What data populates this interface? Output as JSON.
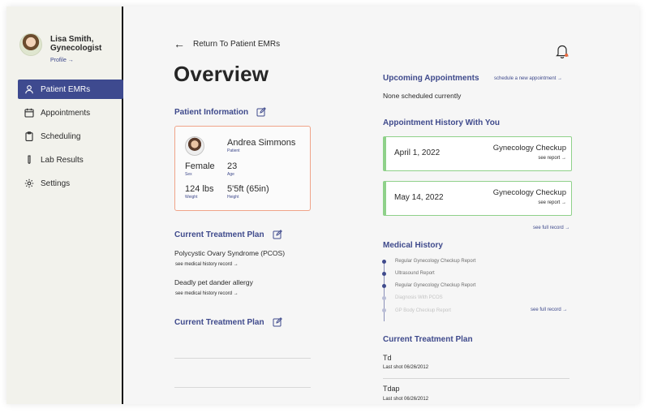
{
  "sidebar": {
    "profile_name": "Lisa Smith, Gynecologist",
    "profile_link": "Profile →",
    "items": [
      {
        "label": "Patient EMRs",
        "active": true
      },
      {
        "label": "Appointments"
      },
      {
        "label": "Scheduling"
      },
      {
        "label": "Lab Results"
      },
      {
        "label": "Settings"
      }
    ]
  },
  "header": {
    "back_label": "Return To Patient EMRs",
    "title": "Overview"
  },
  "patient_info": {
    "heading": "Patient Information",
    "name": "Andrea Simmons",
    "name_caption": "Patient",
    "sex": "Female",
    "sex_caption": "Sex",
    "age": "23",
    "age_caption": "Age",
    "weight": "124 lbs",
    "weight_caption": "Weight",
    "height": "5'5ft (65in)",
    "height_caption": "Height"
  },
  "treatment_plan_left": {
    "heading": "Current Treatment Plan",
    "items": [
      {
        "label": "Polycystic Ovary Syndrome (PCOS)",
        "link": "see medical history record →"
      },
      {
        "label": "Deadly pet dander allergy",
        "link": "see medical history record →"
      }
    ]
  },
  "treatment_plan_left_2": {
    "heading": "Current Treatment Plan"
  },
  "upcoming": {
    "heading": "Upcoming Appointments",
    "link": "schedule a new appointment →",
    "empty": "None scheduled currently"
  },
  "history": {
    "heading": "Appointment History With You",
    "cards": [
      {
        "date": "April 1, 2022",
        "type": "Gynecology Checkup",
        "link": "see report →"
      },
      {
        "date": "May 14, 2022",
        "type": "Gynecology Checkup",
        "link": "see report →"
      }
    ],
    "full_link": "see full record →"
  },
  "medical_history": {
    "heading": "Medical History",
    "items": [
      "Regular Gynecology Checkup Report",
      "Ultrasound Report",
      "Regular Gynecology Checkup Report",
      "Diagnosis With PCOS",
      "GP Body Checkup Report"
    ],
    "full_link": "see full record →"
  },
  "treatment_plan_right": {
    "heading": "Current Treatment Plan",
    "items": [
      {
        "name": "Td",
        "sub": "Last shot 06/26/2012"
      },
      {
        "name": "Tdap",
        "sub": "Last shot 06/26/2012"
      }
    ]
  },
  "colors": {
    "accent": "#3e4a8f",
    "card_border": "#f0a489",
    "appointment_border": "#8fd18a",
    "notification_dot": "#e8683f"
  },
  "icons": [
    "user-icon",
    "calendar-icon",
    "clipboard-icon",
    "test-tube-icon",
    "gear-icon",
    "bell-icon",
    "edit-icon",
    "back-arrow-icon"
  ]
}
